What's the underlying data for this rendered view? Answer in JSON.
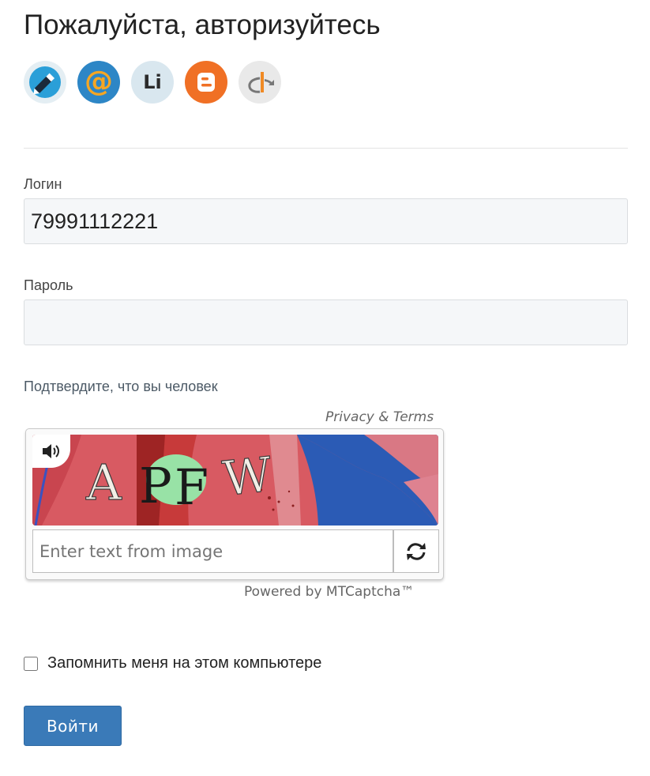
{
  "header": {
    "title": "Пожалуйста, авторизуйтесь"
  },
  "social_logins": [
    {
      "icon": "livejournal-icon",
      "label": ""
    },
    {
      "icon": "mail-ru-icon",
      "label": "@"
    },
    {
      "icon": "liveinternet-icon",
      "label": "Li"
    },
    {
      "icon": "blogger-icon",
      "label": ""
    },
    {
      "icon": "openid-icon",
      "label": ""
    }
  ],
  "form": {
    "login_label": "Логин",
    "login_value": "79991112221",
    "password_label": "Пароль",
    "password_value": "",
    "captcha_prompt": "Подтвердите, что вы человек",
    "remember_label": "Запомнить меня на этом компьютере",
    "remember_checked": false,
    "submit_label": "Войти"
  },
  "captcha": {
    "privacy_link": "Privacy & Terms",
    "image_text": "APFW",
    "input_placeholder": "Enter text from image",
    "powered_by": "Powered by MTCaptcha™"
  },
  "colors": {
    "accent": "#3a7ab8",
    "mail": "#2d86c6",
    "blogger": "#f07025",
    "captcha_red": "#d85a62",
    "captcha_blue": "#2b5bb5"
  }
}
